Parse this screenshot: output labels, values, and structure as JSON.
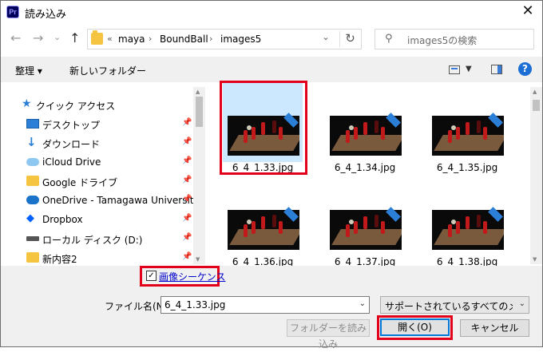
{
  "window": {
    "title": "読み込み",
    "app_badge": "Pr",
    "close_glyph": "✕"
  },
  "nav": {
    "back": "←",
    "forward": "→",
    "history": "⌄",
    "up": "↑"
  },
  "address": {
    "breadcrumbs": [
      "maya",
      "BoundBall",
      "images5"
    ],
    "overflow": "«",
    "separator": "›",
    "dropdown": "⌄",
    "refresh": "↻"
  },
  "search": {
    "placeholder": "images5の検索",
    "icon": "⚲"
  },
  "toolbar": {
    "organize": "整理 ▾",
    "new_folder": "新しいフォルダー",
    "help": "?"
  },
  "sidebar": {
    "items": [
      {
        "label": "クイック アクセス",
        "icon": "star-icon",
        "pinned": false
      },
      {
        "label": "デスクトップ",
        "icon": "desktop-icon",
        "pinned": true
      },
      {
        "label": "ダウンロード",
        "icon": "download-icon",
        "pinned": true
      },
      {
        "label": "iCloud Drive",
        "icon": "cloud-icon",
        "pinned": true
      },
      {
        "label": "Google ドライブ",
        "icon": "folder-icon",
        "pinned": true
      },
      {
        "label": "OneDrive - Tamagawa University",
        "icon": "onedrive-icon",
        "pinned": true
      },
      {
        "label": "Dropbox",
        "icon": "dropbox-icon",
        "pinned": true
      },
      {
        "label": "ローカル ディスク (D:)",
        "icon": "drive-icon",
        "pinned": true
      },
      {
        "label": "新内容2",
        "icon": "folder-sync-icon",
        "pinned": true
      }
    ],
    "pin_glyph": "📌"
  },
  "files": [
    {
      "name": "6_4_1.33.jpg",
      "selected": true
    },
    {
      "name": "6_4_1.34.jpg",
      "selected": false
    },
    {
      "name": "6_4_1.35.jpg",
      "selected": false
    },
    {
      "name": "6_4_1.36.jpg",
      "selected": false
    },
    {
      "name": "6_4_1.37.jpg",
      "selected": false
    },
    {
      "name": "6_4_1.38.jpg",
      "selected": false
    }
  ],
  "footer": {
    "image_sequence_label": "画像シーケンス",
    "image_sequence_checked": true,
    "check_glyph": "✓",
    "filename_label": "ファイル名(N):",
    "filename_value": "6_4_1.33.jpg",
    "filter_value": "サポートされているすべてのメディア (*",
    "dropdown": "⌄",
    "import_folder": "フォルダーを読み込み",
    "open": "開く(O)",
    "cancel": "キャンセル"
  },
  "colors": {
    "highlight": "#e2001a",
    "selection": "#cce8ff",
    "accent": "#0078d7"
  }
}
